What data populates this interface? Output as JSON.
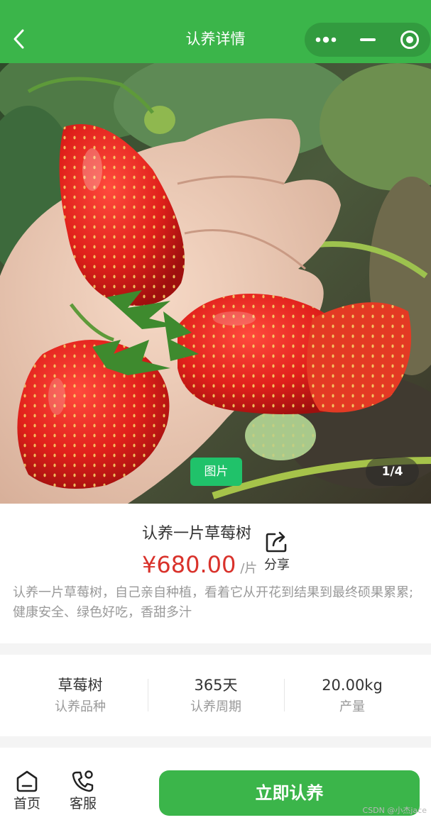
{
  "nav": {
    "title": "认养详情",
    "bar_color": "#3bb54a",
    "back_icon": "chevron-left-icon",
    "capsule_icons": [
      "more-dots-icon",
      "minimize-icon",
      "close-circle-icon"
    ]
  },
  "gallery": {
    "tag": "图片",
    "counter": "1/4",
    "tag_color": "#20c26a"
  },
  "product": {
    "name": "认养一片草莓树",
    "price": "¥680.00",
    "unit": "/片",
    "price_color": "#d9322b",
    "share_label": "分享",
    "share_icon": "share-icon",
    "description": "认养一片草莓树，自己亲自种植，看着它从开花到结果到最终硕果累累;健康安全、绿色好吃，香甜多汁"
  },
  "stats": [
    {
      "value": "草莓树",
      "label": "认养品种"
    },
    {
      "value": "365天",
      "label": "认养周期"
    },
    {
      "value": "20.00kg",
      "label": "产量"
    }
  ],
  "bottom": {
    "tabs": [
      {
        "label": "首页",
        "icon": "home-icon"
      },
      {
        "label": "客服",
        "icon": "phone-icon"
      }
    ],
    "cta_label": "立即认养",
    "cta_color": "#3bb54a"
  },
  "watermark": "CSDN @小杰jace"
}
